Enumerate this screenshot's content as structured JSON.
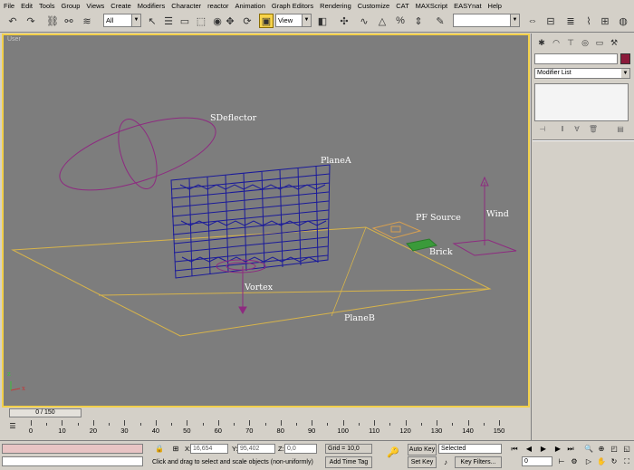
{
  "menu": [
    "File",
    "Edit",
    "Tools",
    "Group",
    "Views",
    "Create",
    "Modifiers",
    "Character",
    "reactor",
    "Animation",
    "Graph Editors",
    "Rendering",
    "Customize",
    "CAT",
    "MAXScript",
    "EASYnat",
    "Help"
  ],
  "toolbar": {
    "selection_filter": "All",
    "reference_coord": "View",
    "named_selection": ""
  },
  "viewport": {
    "name": "User",
    "labels": {
      "sdeflector": "SDeflector",
      "planeA": "PlaneA",
      "pfsource": "PF Source",
      "wind": "Wind",
      "brick": "Brick",
      "vortex": "Vortex",
      "planeB": "PlaneB"
    },
    "axis": {
      "z": "z",
      "x": "x"
    }
  },
  "command_panel": {
    "object_name": "",
    "object_color": "#8b1a3a",
    "modifier_list": "Modifier List"
  },
  "time_slider": {
    "label": "0 / 150",
    "current": 0,
    "total": 150
  },
  "trackbar": {
    "ticks": [
      "0",
      "10",
      "20",
      "30",
      "40",
      "50",
      "60",
      "70",
      "80",
      "90",
      "100",
      "110",
      "120",
      "130",
      "140",
      "150"
    ]
  },
  "status": {
    "x_label": "X:",
    "x_value": "16,654",
    "y_label": "Y:",
    "y_value": "95,402",
    "z_label": "Z:",
    "z_value": "0,0",
    "grid": "Grid = 10,0",
    "prompt": "Click and drag to select and scale objects (non-uniformly)",
    "add_time_tag": "Add Time Tag",
    "auto_key": "Auto Key",
    "set_key": "Set Key",
    "key_mode": "Selected",
    "key_filters": "Key Filters...",
    "frame": "0"
  }
}
